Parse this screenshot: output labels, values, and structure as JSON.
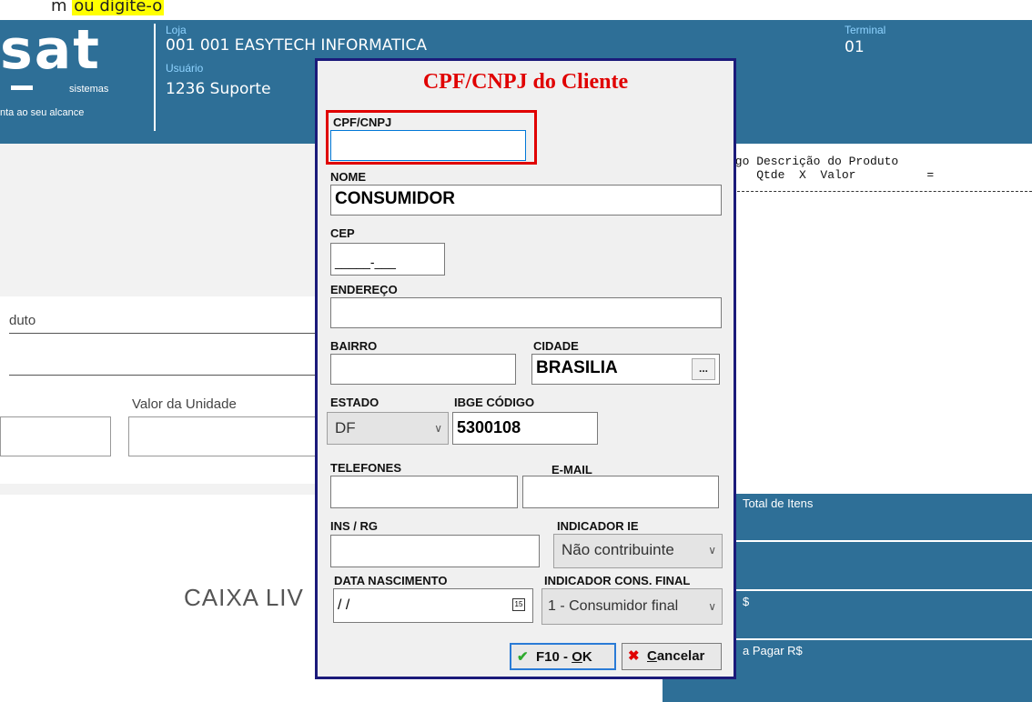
{
  "top_strip": {
    "prefix": "m",
    "highlight": "ou digite-o"
  },
  "header": {
    "logo_text": "sat",
    "logo_sub": "sistemas",
    "logo_tagline": "nta ao seu alcance",
    "loja_label": "Loja",
    "loja_value": "001 001 EASYTECH INFORMATICA",
    "usuario_label": "Usuário",
    "usuario_value": "1236 Suporte",
    "terminal_label": "Terminal",
    "terminal_value": "01"
  },
  "main": {
    "produto_label": "duto",
    "valor_unidade_label": "Valor da Unidade",
    "caixa_text": "CAIXA LIV"
  },
  "receipt": {
    "header_line1": "igo Descrição do Produto",
    "header_line2": "    Qtde  X  Valor          ="
  },
  "right_panel": {
    "total_itens": "Total de Itens",
    "rs": "$",
    "a_pagar": "a Pagar R$"
  },
  "dialog": {
    "title": "CPF/CNPJ do Cliente",
    "cpf_label": "CPF/CNPJ",
    "cpf_value": "",
    "nome_label": "NOME",
    "nome_value": "CONSUMIDOR",
    "cep_label": "CEP",
    "cep_value": "_____-___",
    "endereco_label": "ENDEREÇO",
    "endereco_value": "",
    "bairro_label": "BAIRRO",
    "bairro_value": "",
    "cidade_label": "CIDADE",
    "cidade_value": "BRASILIA",
    "cidade_btn": "...",
    "estado_label": "ESTADO",
    "estado_value": "DF",
    "ibge_label": "IBGE CÓDIGO",
    "ibge_value": "5300108",
    "telefones_label": "TELEFONES",
    "telefones_value": "",
    "email_label": "E-MAIL",
    "email_value": "",
    "ins_label": "INS / RG",
    "ins_value": "",
    "indicador_ie_label": "INDICADOR IE",
    "indicador_ie_value": "Não contribuinte",
    "data_nasc_label": "DATA NASCIMENTO",
    "data_nasc_value": " / /",
    "ind_cons_label": "INDICADOR CONS. FINAL",
    "ind_cons_value": "1 - Consumidor final",
    "ok_prefix": "F10 - ",
    "ok_key": "O",
    "ok_rest": "K",
    "cancel_key": "C",
    "cancel_rest": "ancelar"
  },
  "colors": {
    "header_blue": "#2e6f97",
    "dialog_border": "#1b1a7a",
    "title_red": "#e00000",
    "highlight": "#ffff00"
  }
}
